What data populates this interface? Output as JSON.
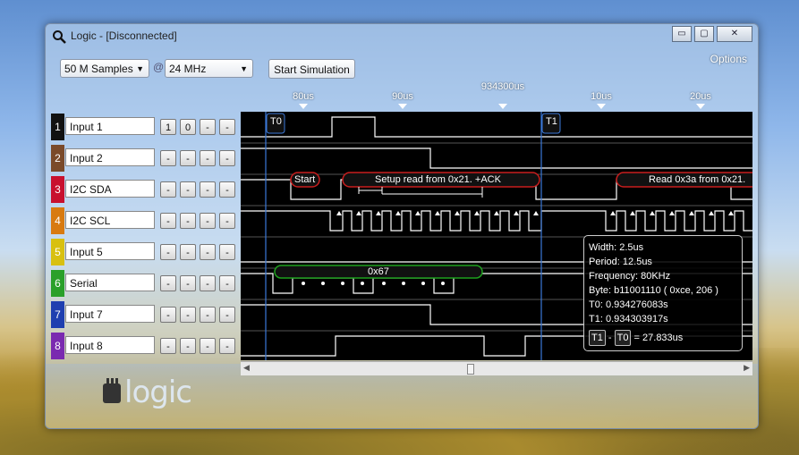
{
  "window": {
    "title": "Logic - [Disconnected]",
    "minimize": "▭",
    "maximize": "▢",
    "close": "✕"
  },
  "toolbar": {
    "samples": "50 M Samples",
    "at": "@",
    "rate": "24 MHz",
    "start_simulation": "Start Simulation",
    "options": "Options"
  },
  "timeline": {
    "labels": [
      "80us",
      "90us",
      "934300us",
      "10us",
      "20us"
    ]
  },
  "channels": [
    {
      "num": "1",
      "name": "Input 1",
      "color": "#111111",
      "triggers": [
        "1",
        "0",
        "-",
        "-"
      ]
    },
    {
      "num": "2",
      "name": "Input 2",
      "color": "#7a4a2a",
      "triggers": [
        "-",
        "-",
        "-",
        "-"
      ]
    },
    {
      "num": "3",
      "name": "I2C SDA",
      "color": "#c8102e",
      "triggers": [
        "-",
        "-",
        "-",
        "-"
      ]
    },
    {
      "num": "4",
      "name": "I2C SCL",
      "color": "#d87a10",
      "triggers": [
        "-",
        "-",
        "-",
        "-"
      ]
    },
    {
      "num": "5",
      "name": "Input 5",
      "color": "#d8c010",
      "triggers": [
        "-",
        "-",
        "-",
        "-"
      ]
    },
    {
      "num": "6",
      "name": "Serial",
      "color": "#2aa02a",
      "triggers": [
        "-",
        "-",
        "-",
        "-"
      ]
    },
    {
      "num": "7",
      "name": "Input 7",
      "color": "#1f3fb0",
      "triggers": [
        "-",
        "-",
        "-",
        "-"
      ]
    },
    {
      "num": "8",
      "name": "Input 8",
      "color": "#7a2ab0",
      "triggers": [
        "-",
        "-",
        "-",
        "-"
      ]
    }
  ],
  "markers": {
    "t0": "T0",
    "t1": "T1"
  },
  "annotations": {
    "start": "Start",
    "setup": "Setup read from 0x21. +ACK",
    "read": "Read 0x3a from 0x21.",
    "serial": "0x67"
  },
  "tooltip": {
    "width": "Width: 2.5us",
    "period": "Period: 12.5us",
    "frequency": "Frequency: 80KHz",
    "byte": "Byte: b11001110 ( 0xce, 206 )",
    "t0": "T0: 0.934276083s",
    "t1": "T1: 0.934303917s",
    "t1_label": "T1",
    "minus": "-",
    "t0_label": "T0",
    "diff": "= 27.833us"
  },
  "logo": {
    "text": "logic"
  },
  "colors": {
    "marker": "#3a78d8",
    "sda_bubble": "#c81e1e",
    "serial_bubble": "#1ea01e"
  }
}
